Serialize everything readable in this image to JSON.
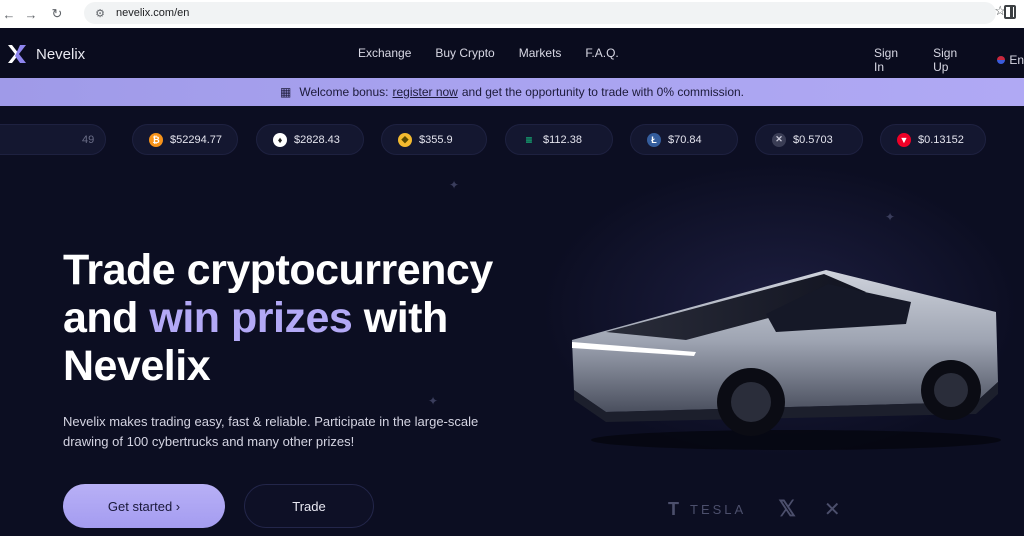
{
  "browser": {
    "url": "nevelix.com/en",
    "back_icon": "arrow-left-icon",
    "forward_icon": "arrow-right-icon",
    "reload_icon": "reload-icon",
    "site_info_icon": "tune-icon",
    "bookmark_icon": "star-icon",
    "sidepanel_icon": "side-panel-icon"
  },
  "header": {
    "brand": "Nevelix",
    "nav": [
      "Exchange",
      "Buy Crypto",
      "Markets",
      "F.A.Q."
    ],
    "sign_in": "Sign In",
    "sign_up": "Sign Up",
    "lang": "En"
  },
  "promo": {
    "prefix": "Welcome bonus:",
    "link": "register now",
    "suffix": "and get the opportunity to trade with 0% commission."
  },
  "ticker": [
    {
      "price": "49",
      "color": "#f7931a",
      "icon": "partial-coin-icon"
    },
    {
      "price": "$52294.77",
      "color": "#f7931a",
      "icon": "bitcoin-icon"
    },
    {
      "price": "$2828.43",
      "color": "#ffffff",
      "icon": "ethereum-icon"
    },
    {
      "price": "$355.9",
      "color": "#f3ba2f",
      "icon": "bnb-icon"
    },
    {
      "price": "$112.38",
      "color": "#14f195",
      "icon": "solana-icon"
    },
    {
      "price": "$70.84",
      "color": "#345d9d",
      "icon": "litecoin-icon"
    },
    {
      "price": "$0.5703",
      "color": "#3a3d55",
      "icon": "xrp-icon"
    },
    {
      "price": "$0.13152",
      "color": "#ef0027",
      "icon": "tron-icon"
    }
  ],
  "hero": {
    "line1": "Trade cryptocurrency",
    "line2_pre": "and",
    "line2_accent": "win prizes",
    "line2_post": "with",
    "line3": "Nevelix",
    "description": "Nevelix makes trading easy, fast & reliable. Participate in the large-scale drawing of 100 cybertrucks and many other prizes!",
    "cta_primary": "Get started ›",
    "cta_secondary": "Trade",
    "accent_color": "#b3a9f6"
  },
  "partners": {
    "tesla": "TESLA"
  }
}
